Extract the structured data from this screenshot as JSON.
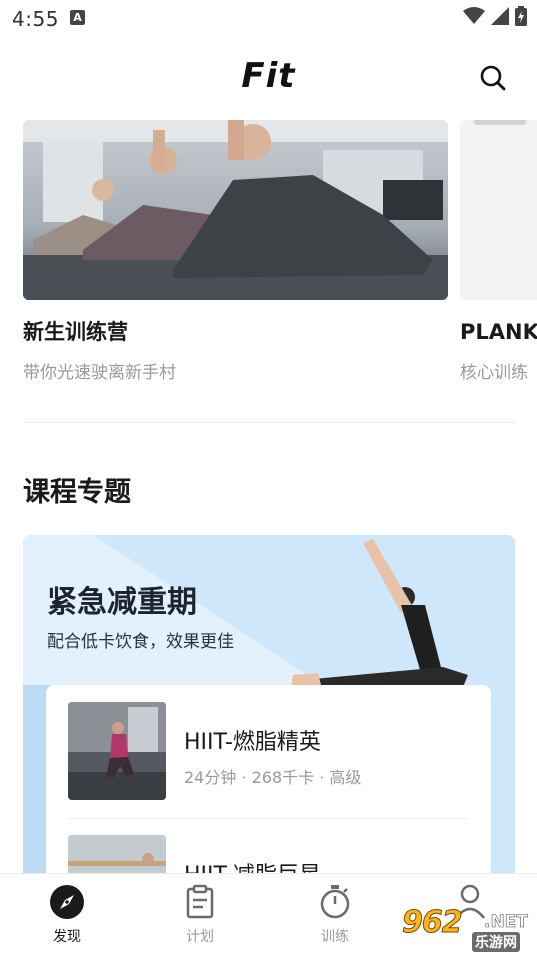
{
  "status_bar": {
    "time": "4:55",
    "notification_badge": "A"
  },
  "header": {
    "logo": "Fit",
    "search_icon": "search-icon"
  },
  "camps": [
    {
      "title": "新生训练营",
      "subtitle": "带你光速驶离新手村"
    },
    {
      "title": "PLANK大",
      "subtitle": "核心训练"
    }
  ],
  "section": {
    "title": "课程专题"
  },
  "feature": {
    "title": "紧急减重期",
    "subtitle": "配合低卡饮食，效果更佳",
    "accent": "#cfe7fb",
    "courses": [
      {
        "name": "HIIT-燃脂精英",
        "meta": "24分钟 · 268千卡 · 高级"
      },
      {
        "name": "HIIT-减脂巨星",
        "meta": ""
      }
    ]
  },
  "bottom_nav": {
    "items": [
      {
        "label": "发现",
        "icon": "compass-icon",
        "active": true
      },
      {
        "label": "计划",
        "icon": "clipboard-icon",
        "active": false
      },
      {
        "label": "训练",
        "icon": "stopwatch-icon",
        "active": false
      },
      {
        "label": "",
        "icon": "profile-icon",
        "active": false
      }
    ]
  },
  "watermark": {
    "number": "962",
    "domain": ".NET",
    "name": "乐游网"
  }
}
